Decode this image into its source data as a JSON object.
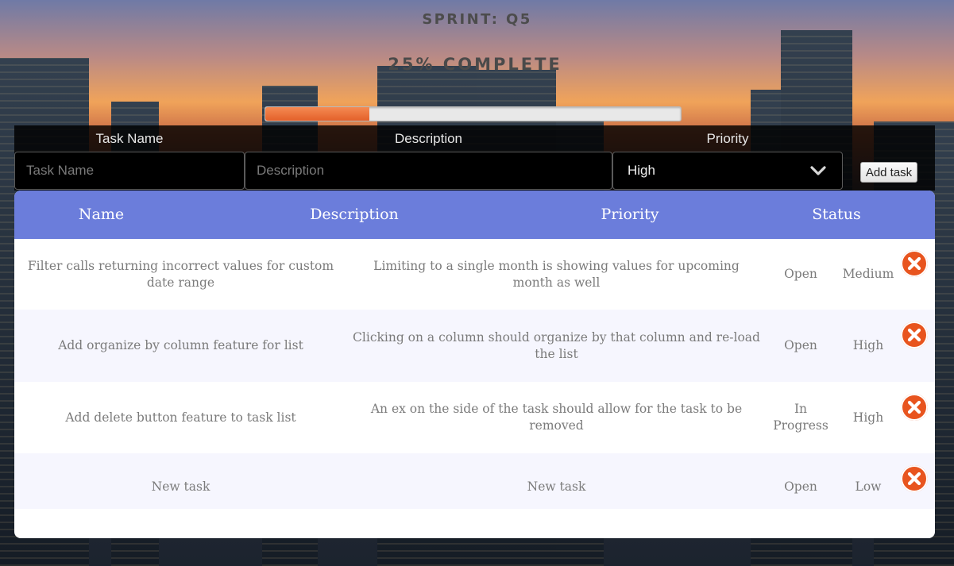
{
  "sprint": {
    "title": "SPRINT: Q5"
  },
  "progress": {
    "label": "25% COMPLETE",
    "fraction": 0.25,
    "fill_color": "#ec6b35"
  },
  "form": {
    "labels": {
      "task_name": "Task Name",
      "description": "Description",
      "priority": "Priority"
    },
    "task_name_placeholder": "Task Name",
    "description_placeholder": "Description",
    "priority_selected": "High",
    "add_button": "Add task"
  },
  "table": {
    "header_color": "#6b7ddb",
    "headers": {
      "name": "Name",
      "description": "Description",
      "priority": "Priority",
      "status": "Status"
    },
    "rows": [
      {
        "name": "Filter calls returning incorrect values for custom date range",
        "description": "Limiting to a single month is showing values for upcoming month as well",
        "status": "Open",
        "priority": "Medium"
      },
      {
        "name": "Add organize by column feature for list",
        "description": "Clicking on a column should organize by that column and re-load the list",
        "status": "Open",
        "priority": "High"
      },
      {
        "name": "Add delete button feature to task list",
        "description": "An ex on the side of the task should allow for the task to be removed",
        "status": "In Progress",
        "priority": "High"
      },
      {
        "name": "New task",
        "description": "New task",
        "status": "Open",
        "priority": "Low"
      }
    ],
    "delete_icon": "close-circle-icon",
    "delete_color": "#e8541e"
  }
}
